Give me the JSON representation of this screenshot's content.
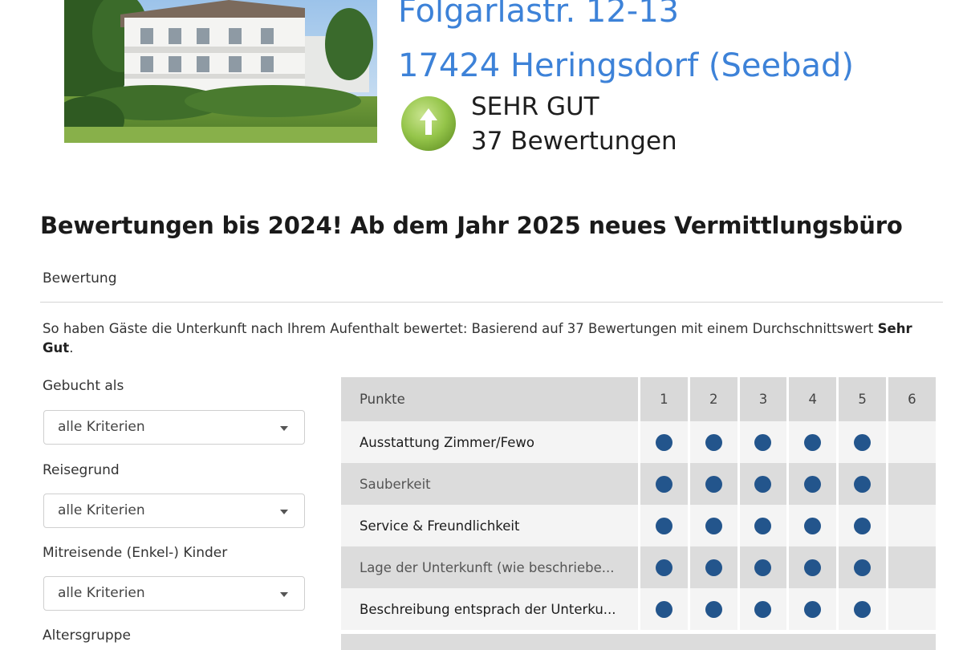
{
  "listing": {
    "street": "Folgarlastr. 12-13",
    "city": "17424 Heringsdorf (Seebad)",
    "rating_word": "SEHR GUT",
    "review_count": "37 Bewertungen",
    "rating_icon": "arrow-up-icon",
    "colors": {
      "address": "#3d82d8",
      "rating_green": "#8bbf3c",
      "dot": "#23558c"
    }
  },
  "notice": "Bewertungen bis 2024! Ab dem Jahr 2025 neues Vermittlungsbüro",
  "section_label": "Bewertung",
  "summary": {
    "text": "So haben Gäste die Unterkunft nach Ihrem Aufenthalt bewertet:  Basierend auf 37 Bewertungen mit einem Durchschnittswert",
    "bold": "Sehr Gut",
    "end": "."
  },
  "filters": [
    {
      "label": "Gebucht als",
      "value": "alle Kriterien"
    },
    {
      "label": "Reisegrund",
      "value": "alle Kriterien"
    },
    {
      "label": "Mitreisende (Enkel-) Kinder",
      "value": "alle Kriterien"
    },
    {
      "label": "Altersgruppe",
      "value": ""
    }
  ],
  "table": {
    "header_label": "Punkte",
    "columns": [
      "1",
      "2",
      "3",
      "4",
      "5",
      "6"
    ],
    "rows": [
      {
        "label": "Ausstattung Zimmer/Fewo",
        "score": 5
      },
      {
        "label": "Sauberkeit",
        "score": 5
      },
      {
        "label": "Service & Freundlichkeit",
        "score": 5
      },
      {
        "label": "Lage der Unterkunft (wie beschriebe...",
        "score": 5
      },
      {
        "label": "Beschreibung entsprach der Unterku...",
        "score": 5
      }
    ]
  }
}
